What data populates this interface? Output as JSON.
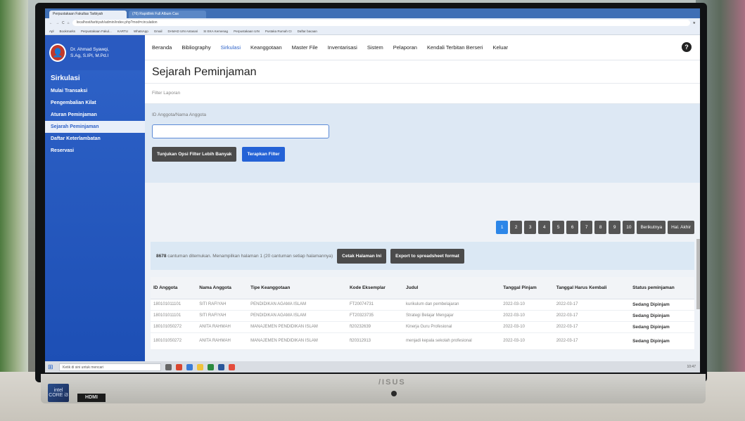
{
  "browser": {
    "tabs": [
      "Perpustakaan Fakultas Tarbiyah",
      "(76) Rapidlink Full Album Cas"
    ],
    "url": "localhost/tarbiyah/admin/index.php?mod=circulation",
    "bookmarks": [
      "Apl",
      "Bookmarks",
      "Perpustakaan Fakul...",
      "KARTU",
      "WhatsApp",
      "Gmail",
      "DAMAD UIN Antasari",
      "SI EKA Kemenag",
      "Perpustakaan UIN",
      "Pustaka Rumah CI",
      "Daftar bacaan"
    ]
  },
  "user": {
    "name": "Dr. Ahmad Syawqi,",
    "title": "S.Ag, S.IPI, M.Pd.I"
  },
  "sidebar": {
    "title": "Sirkulasi",
    "items": [
      {
        "label": "Mulai Transaksi",
        "active": false
      },
      {
        "label": "Pengembalian Kilat",
        "active": false
      },
      {
        "label": "Aturan Peminjaman",
        "active": false
      },
      {
        "label": "Sejarah Peminjaman",
        "active": true
      },
      {
        "label": "Daftar Keterlambatan",
        "active": false
      },
      {
        "label": "Reservasi",
        "active": false
      }
    ]
  },
  "topnav": [
    {
      "label": "Beranda",
      "active": false
    },
    {
      "label": "Bibliography",
      "active": false
    },
    {
      "label": "Sirkulasi",
      "active": true
    },
    {
      "label": "Keanggotaan",
      "active": false
    },
    {
      "label": "Master File",
      "active": false
    },
    {
      "label": "Inventarisasi",
      "active": false
    },
    {
      "label": "Sistem",
      "active": false
    },
    {
      "label": "Pelaporan",
      "active": false
    },
    {
      "label": "Kendali Terbitan Berseri",
      "active": false
    },
    {
      "label": "Keluar",
      "active": false
    }
  ],
  "page": {
    "title": "Sejarah Peminjaman",
    "filter_header": "Filter Laporan",
    "member_label": "ID Anggota/Nama Anggota",
    "member_value": "",
    "more_filter_btn": "Tunjukan Opsi Filter Lebih Banyak",
    "apply_btn": "Terapkan Filter"
  },
  "pager": {
    "pages": [
      "1",
      "2",
      "3",
      "4",
      "5",
      "6",
      "7",
      "8",
      "9",
      "10"
    ],
    "current": "1",
    "next": "Berikutnya",
    "last": "Hal. Akhir"
  },
  "info": {
    "count": "8678",
    "text": " cantuman ditemukan. Menampilkan halaman 1 (20 cantuman setiap halamannya)",
    "print_btn": "Cetak Halaman Ini",
    "export_btn": "Export to spreadsheet format"
  },
  "table": {
    "headers": [
      "ID Anggota",
      "Nama Anggota",
      "Tipe Keanggotaan",
      "Kode Eksemplar",
      "Judul",
      "Tanggal Pinjam",
      "Tanggal Harus Kembali",
      "Status peminjaman"
    ],
    "rows": [
      [
        "180101011101",
        "SITI RAFIYAH",
        "PENDIDIKAN AGAMA ISLAM",
        "FT20074731",
        "kurikulum dan pembelajaran",
        "2022-03-10",
        "2022-03-17",
        "Sedang Dipinjam"
      ],
      [
        "180101011101",
        "SITI RAFIYAH",
        "PENDIDIKAN AGAMA ISLAM",
        "FT20323735",
        "Strategi Belajar Mengajar",
        "2022-03-10",
        "2022-03-17",
        "Sedang Dipinjam"
      ],
      [
        "180101050272",
        "ANITA RAHMAH",
        "MANAJEMEN PENDIDIKAN ISLAM",
        "ft20232639",
        "Kinerja Guru Profesional",
        "2022-03-10",
        "2022-03-17",
        "Sedang Dipinjam"
      ],
      [
        "180101050272",
        "ANITA RAHMAH",
        "MANAJEMEN PENDIDIKAN ISLAM",
        "ft20312913",
        "menjadi kepala sekolah profesional",
        "2022-03-10",
        "2022-03-17",
        "Sedang Dipinjam"
      ]
    ]
  },
  "taskbar": {
    "search_placeholder": "Ketik di sini untuk mencari",
    "tray": "10:47"
  },
  "hardware": {
    "brand": "/ISUS",
    "sticker_intel": "intel",
    "sticker_core": "CORE i3",
    "hdmi": "HDMI"
  },
  "colors": {
    "sidebar": "#2f63c8",
    "accent": "#2462d6",
    "pager_active": "#2c86e8"
  }
}
